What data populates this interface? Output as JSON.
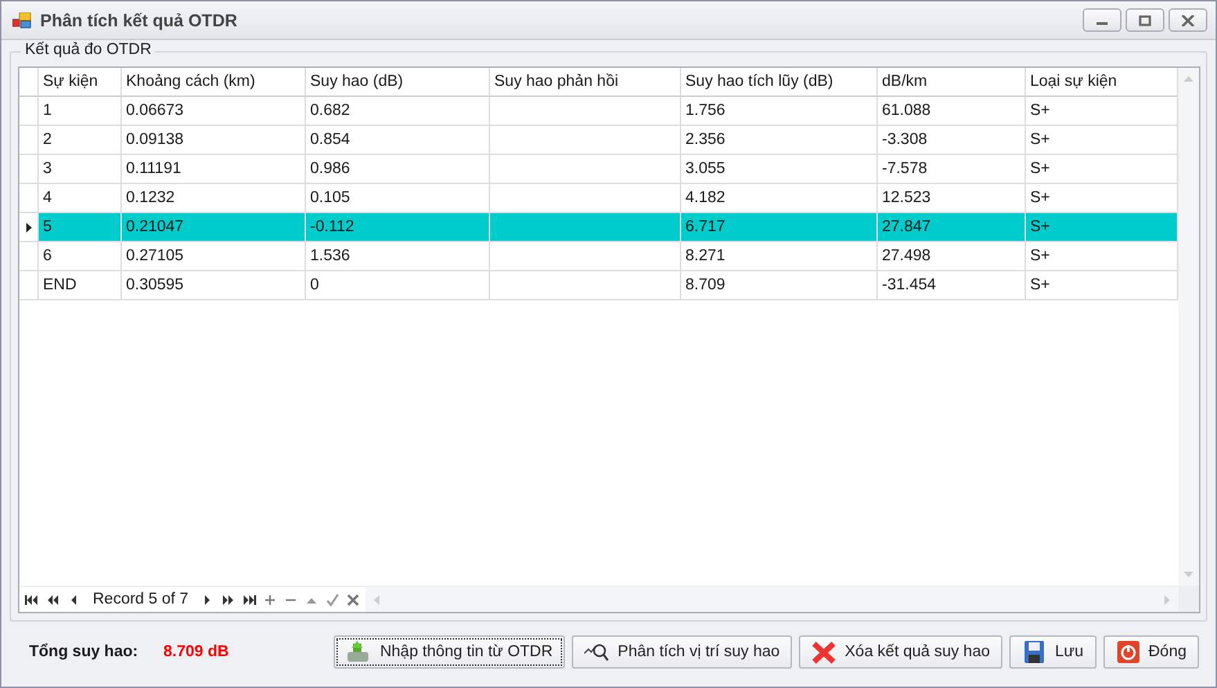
{
  "window": {
    "title": "Phân tích kết quả OTDR"
  },
  "group": {
    "title": "Kết quả đo OTDR"
  },
  "table": {
    "columns": [
      "Sự kiện",
      "Khoảng cách (km)",
      "Suy hao (dB)",
      "Suy hao phản hồi",
      "Suy hao tích lũy (dB)",
      "dB/km",
      "Loại sự kiện"
    ],
    "rows": [
      {
        "cells": [
          "1",
          "0.06673",
          "0.682",
          "",
          "1.756",
          "61.088",
          "S+"
        ],
        "selected": false
      },
      {
        "cells": [
          "2",
          "0.09138",
          "0.854",
          "",
          "2.356",
          "-3.308",
          "S+"
        ],
        "selected": false
      },
      {
        "cells": [
          "3",
          "0.11191",
          "0.986",
          "",
          "3.055",
          "-7.578",
          "S+"
        ],
        "selected": false
      },
      {
        "cells": [
          "4",
          "0.1232",
          "0.105",
          "",
          "4.182",
          "12.523",
          "S+"
        ],
        "selected": false
      },
      {
        "cells": [
          "5",
          "0.21047",
          "-0.112",
          "",
          "6.717",
          "27.847",
          "S+"
        ],
        "selected": true
      },
      {
        "cells": [
          "6",
          "0.27105",
          "1.536",
          "",
          "8.271",
          "27.498",
          "S+"
        ],
        "selected": false
      },
      {
        "cells": [
          "END",
          "0.30595",
          "0",
          "",
          "8.709",
          "-31.454",
          "S+"
        ],
        "selected": false
      }
    ]
  },
  "navigator": {
    "record": "Record 5 of 7"
  },
  "total": {
    "label": "Tổng suy hao:",
    "value": "8.709 dB"
  },
  "buttons": [
    {
      "kind": "import",
      "label": "Nhập thông tin từ OTDR"
    },
    {
      "kind": "analyze",
      "label": "Phân tích vị trí suy hao"
    },
    {
      "kind": "delete",
      "label": "Xóa kết quả suy hao"
    },
    {
      "kind": "save",
      "label": "Lưu"
    },
    {
      "kind": "close",
      "label": "Đóng"
    }
  ]
}
